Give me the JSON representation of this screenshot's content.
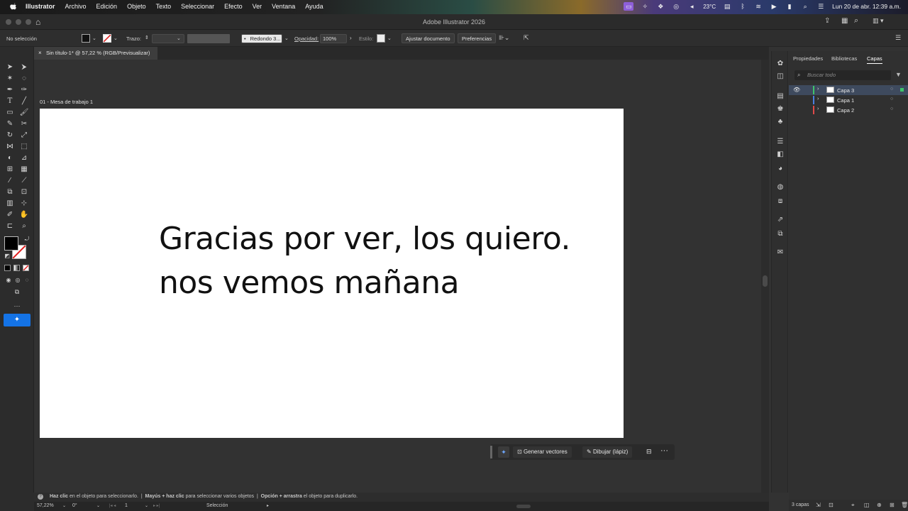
{
  "menubar": {
    "app_name": "Illustrator",
    "items": [
      "Archivo",
      "Edición",
      "Objeto",
      "Texto",
      "Seleccionar",
      "Efecto",
      "Ver",
      "Ventana",
      "Ayuda"
    ],
    "temperature": "23°C",
    "datetime": "Lun 20 de abr.  12:39 a.m."
  },
  "window": {
    "title": "Adobe Illustrator 2026"
  },
  "controlbar": {
    "selection_label": "No selección",
    "stroke_label": "Trazo:",
    "brush_value": "Redondo 3...",
    "opacity_label": "Opacidad:",
    "opacity_value": "100%",
    "style_label": "Estilo:",
    "adjust_button": "Ajustar documento",
    "prefs_button": "Preferencias"
  },
  "document": {
    "tab_title": "Sin título-1* @ 57,22 % (RGB/Previsualizar)",
    "artboard_label": "01 - Mesa de trabajo 1",
    "text_line1": "Gracias por ver, los quiero.",
    "text_line2": "nos vemos mañana"
  },
  "taskbar": {
    "generate_label": "Generar vectores",
    "draw_label": "Dibujar (lápiz)"
  },
  "panel": {
    "tabs": [
      "Propiedades",
      "Bibliotecas",
      "Capas"
    ],
    "search_placeholder": "Buscar todo",
    "layers": [
      {
        "name": "Capa 3",
        "color": "#3fc46b",
        "selected": true
      },
      {
        "name": "Capa 1",
        "color": "#4a7fe0",
        "selected": false
      },
      {
        "name": "Capa 2",
        "color": "#e04a4a",
        "selected": false
      }
    ],
    "layer_count": "3 capas"
  },
  "status": {
    "hint1_bold": "Haz clic",
    "hint1": "en el objeto para seleccionarlo.",
    "hint2_bold": "Mayús + haz clic",
    "hint2": "para seleccionar varios objetos",
    "hint3_bold": "Opción + arrastra",
    "hint3": "el objeto para duplicarlo.",
    "zoom": "57,22%",
    "rotation": "0°",
    "artboard_num": "1",
    "tool_name": "Selección"
  },
  "colors": {
    "accent": "#1473e6",
    "canvas": "#323232",
    "artboard": "#ffffff"
  }
}
